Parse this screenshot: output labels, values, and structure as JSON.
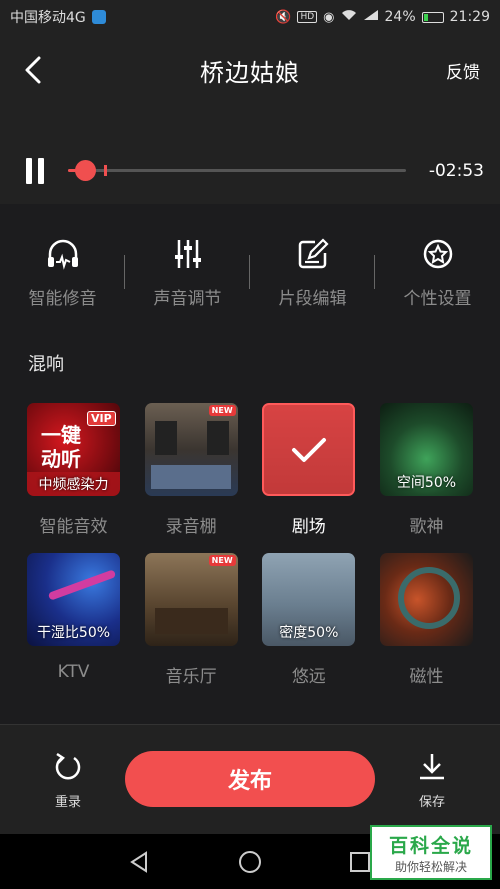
{
  "status_bar": {
    "carrier": "中国移动4G",
    "battery": "24%",
    "battery_level": 0.24,
    "network": "4G",
    "time": "21:29",
    "icons": [
      "mute-icon",
      "hd-icon",
      "eye-icon",
      "wifi-icon",
      "signal-icon",
      "battery-icon"
    ]
  },
  "header": {
    "title": "桥边姑娘",
    "feedback_label": "反馈"
  },
  "player": {
    "remaining": "-02:53",
    "progress": 0.05
  },
  "tools": [
    {
      "label": "智能修音",
      "icon": "headphone-wave-icon"
    },
    {
      "label": "声音调节",
      "icon": "sliders-icon"
    },
    {
      "label": "片段编辑",
      "icon": "edit-icon"
    },
    {
      "label": "个性设置",
      "icon": "settings-star-icon"
    }
  ],
  "section_title": "混响",
  "effects": [
    {
      "name": "智能音效",
      "caption": "中频感染力",
      "badge": "",
      "overlay_main": "一键\n动听",
      "overlay_vip": "VIP",
      "selected": false
    },
    {
      "name": "录音棚",
      "caption": "",
      "badge": "NEW",
      "selected": false
    },
    {
      "name": "剧场",
      "caption": "",
      "badge": "",
      "selected": true
    },
    {
      "name": "歌神",
      "caption": "空间50%",
      "badge": "",
      "selected": false
    },
    {
      "name": "KTV",
      "caption": "干湿比50%",
      "badge": "",
      "selected": false
    },
    {
      "name": "音乐厅",
      "caption": "",
      "badge": "NEW",
      "selected": false
    },
    {
      "name": "悠远",
      "caption": "密度50%",
      "badge": "",
      "selected": false
    },
    {
      "name": "磁性",
      "caption": "",
      "badge": "",
      "selected": false
    }
  ],
  "bottom": {
    "reset_label": "重录",
    "publish_label": "发布",
    "save_label": "保存"
  },
  "watermark": {
    "title": "百科全说",
    "subtitle": "助你轻松解决"
  },
  "colors": {
    "accent": "#f24f4f",
    "background": "#1c1c1e",
    "panel": "#222222"
  }
}
